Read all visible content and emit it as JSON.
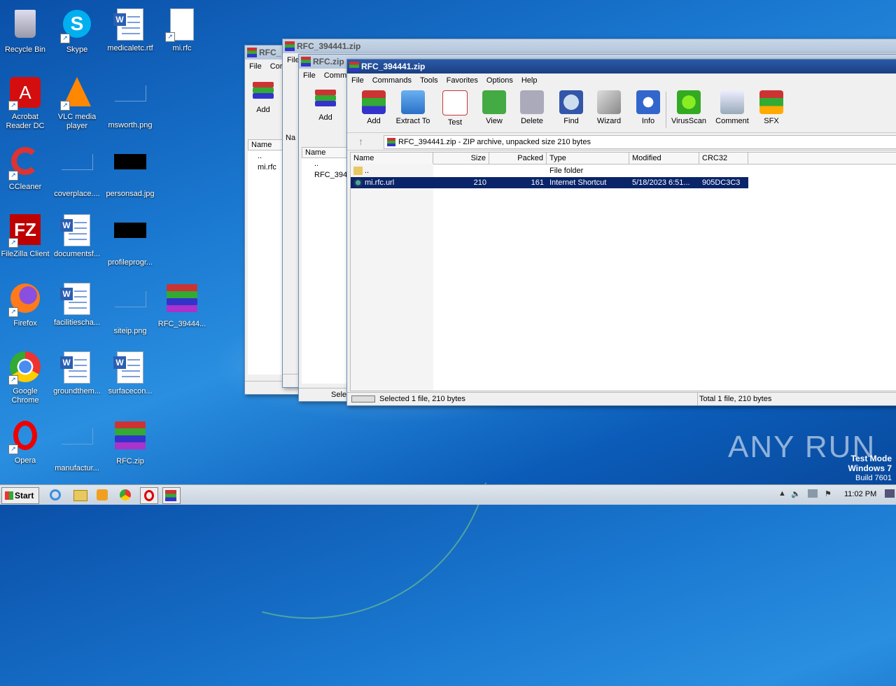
{
  "desktop_icons": [
    {
      "label": "Recycle Bin",
      "icon": "recycle-bin-icon"
    },
    {
      "label": "Skype",
      "icon": "skype-icon"
    },
    {
      "label": "medicaletc.rtf",
      "icon": "word-document-icon"
    },
    {
      "label": "mi.rfc",
      "icon": "blank-file-icon"
    },
    {
      "label": "Acrobat Reader DC",
      "icon": "acrobat-icon"
    },
    {
      "label": "VLC media player",
      "icon": "vlc-icon"
    },
    {
      "label": "msworth.png",
      "icon": "image-file-icon"
    },
    {
      "label": "CCleaner",
      "icon": "ccleaner-icon"
    },
    {
      "label": "coverplace....",
      "icon": "image-file-icon"
    },
    {
      "label": "personsad.jpg",
      "icon": "image-file-icon"
    },
    {
      "label": "FileZilla Client",
      "icon": "filezilla-icon"
    },
    {
      "label": "documentsf...",
      "icon": "word-document-icon"
    },
    {
      "label": "profileprogr...",
      "icon": "image-file-icon"
    },
    {
      "label": "Firefox",
      "icon": "firefox-icon"
    },
    {
      "label": "facilitiescha...",
      "icon": "word-document-icon"
    },
    {
      "label": "siteip.png",
      "icon": "image-file-icon"
    },
    {
      "label": "RFC_39444...",
      "icon": "winrar-archive-icon"
    },
    {
      "label": "Google Chrome",
      "icon": "chrome-icon"
    },
    {
      "label": "groundthem...",
      "icon": "word-document-icon"
    },
    {
      "label": "surfacecon...",
      "icon": "word-document-icon"
    },
    {
      "label": "Opera",
      "icon": "opera-icon"
    },
    {
      "label": "manufactur...",
      "icon": "image-file-icon"
    },
    {
      "label": "RFC.zip",
      "icon": "winrar-archive-icon"
    }
  ],
  "bg_window_1": {
    "title": "RFC_",
    "menu": [
      "File",
      "Cor"
    ],
    "add_label": "Add",
    "col_name": "Name",
    "rows": [
      "..",
      "mi.rfc"
    ]
  },
  "bg_window_2": {
    "title": "RFC_394441.zip",
    "menu": [
      "File"
    ],
    "col_name": "Na"
  },
  "bg_window_3": {
    "title": "RFC.zip",
    "menu": [
      "File",
      "Comm"
    ],
    "add_label": "Add",
    "col_name": "Name",
    "rows": [
      "..",
      "RFC_394"
    ],
    "status": "Sele"
  },
  "main_window": {
    "title": "RFC_394441.zip",
    "menu": [
      "File",
      "Commands",
      "Tools",
      "Favorites",
      "Options",
      "Help"
    ],
    "toolbar": [
      "Add",
      "Extract To",
      "Test",
      "View",
      "Delete",
      "Find",
      "Wizard",
      "Info",
      "VirusScan",
      "Comment",
      "SFX"
    ],
    "address": "RFC_394441.zip - ZIP archive, unpacked size 210 bytes",
    "columns": [
      "Name",
      "Size",
      "Packed",
      "Type",
      "Modified",
      "CRC32"
    ],
    "rows": [
      {
        "name": "..",
        "size": "",
        "packed": "",
        "type": "File folder",
        "modified": "",
        "crc": ""
      },
      {
        "name": "mi.rfc.url",
        "size": "210",
        "packed": "161",
        "type": "Internet Shortcut",
        "modified": "5/18/2023 6:51...",
        "crc": "905DC3C3"
      }
    ],
    "status_left": "Selected 1 file, 210 bytes",
    "status_right": "Total 1 file, 210 bytes"
  },
  "watermark": {
    "brand": "ANY RUN",
    "test_mode": "Test Mode",
    "os": "Windows 7",
    "build": "Build 7601"
  },
  "taskbar": {
    "start": "Start",
    "clock": "11:02 PM"
  }
}
